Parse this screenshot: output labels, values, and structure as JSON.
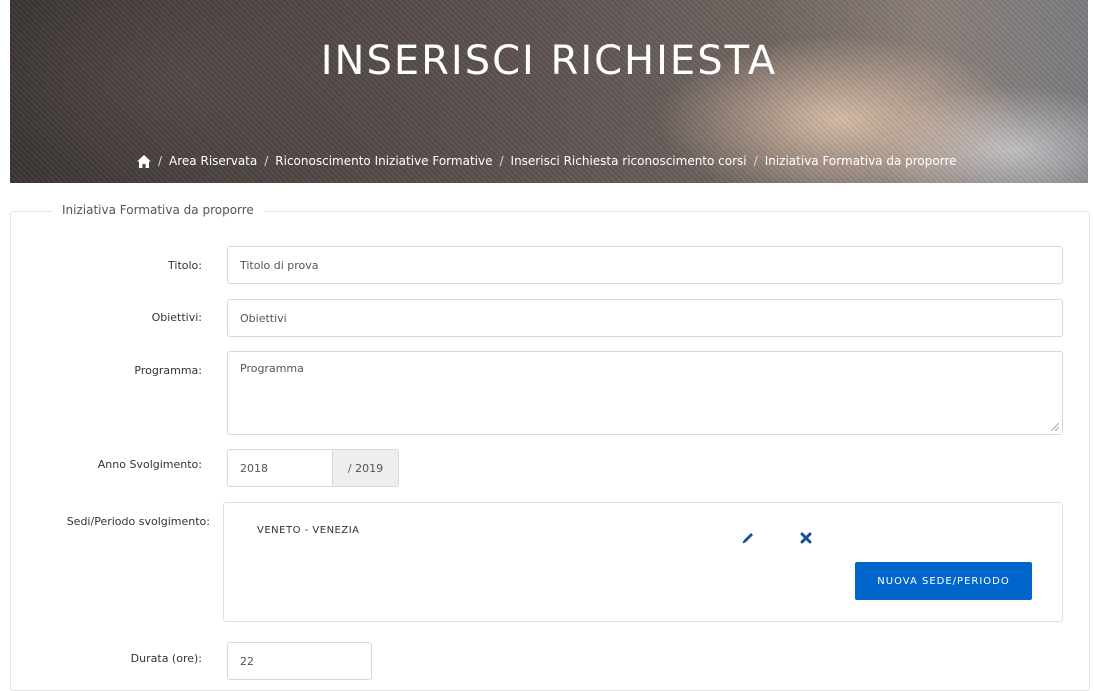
{
  "header": {
    "title": "INSERISCI RICHIESTA",
    "breadcrumb": [
      "Area Riservata",
      "Riconoscimento Iniziative Formative",
      "Inserisci Richiesta riconoscimento corsi",
      "Iniziativa Formativa da proporre"
    ],
    "separator": "/"
  },
  "form": {
    "legend": "Iniziativa Formativa da proporre",
    "titolo": {
      "label": "Titolo:",
      "value": "Titolo di prova"
    },
    "obiettivi": {
      "label": "Obiettivi:",
      "value": "Obiettivi"
    },
    "programma": {
      "label": "Programma:",
      "value": "Programma"
    },
    "anno": {
      "label": "Anno Svolgimento:",
      "value": "2018",
      "suffix": "/ 2019"
    },
    "sedi": {
      "label": "Sedi/Periodo svolgimento:",
      "items": [
        "VENETO - VENEZIA"
      ],
      "new_button": "NUOVA SEDE/PERIODO"
    },
    "durata": {
      "label": "Durata (ore):",
      "value": "22"
    }
  },
  "colors": {
    "primary": "#0066cc",
    "edit_icon": "#1a4d99",
    "delete_icon": "#1a4d99"
  },
  "icons": [
    "home-icon",
    "pencil-icon",
    "close-icon"
  ]
}
